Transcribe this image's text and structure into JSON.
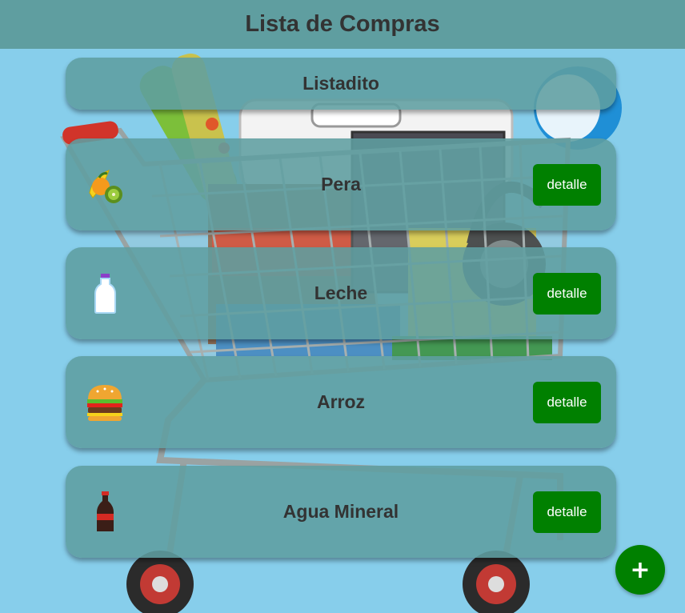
{
  "header": {
    "title": "Lista de Compras"
  },
  "list": {
    "title": "Listadito"
  },
  "items": [
    {
      "name": "Pera",
      "icon": "fruit-icon",
      "button_label": "detalle"
    },
    {
      "name": "Leche",
      "icon": "milk-bottle-icon",
      "button_label": "detalle"
    },
    {
      "name": "Arroz",
      "icon": "burger-icon",
      "button_label": "detalle"
    },
    {
      "name": "Agua Mineral",
      "icon": "soda-bottle-icon",
      "button_label": "detalle"
    }
  ],
  "fab": {
    "label": "+"
  },
  "colors": {
    "header": "#5F9EA0",
    "background": "#87CEEB",
    "button": "#008000",
    "card": "#5F9EA0"
  }
}
